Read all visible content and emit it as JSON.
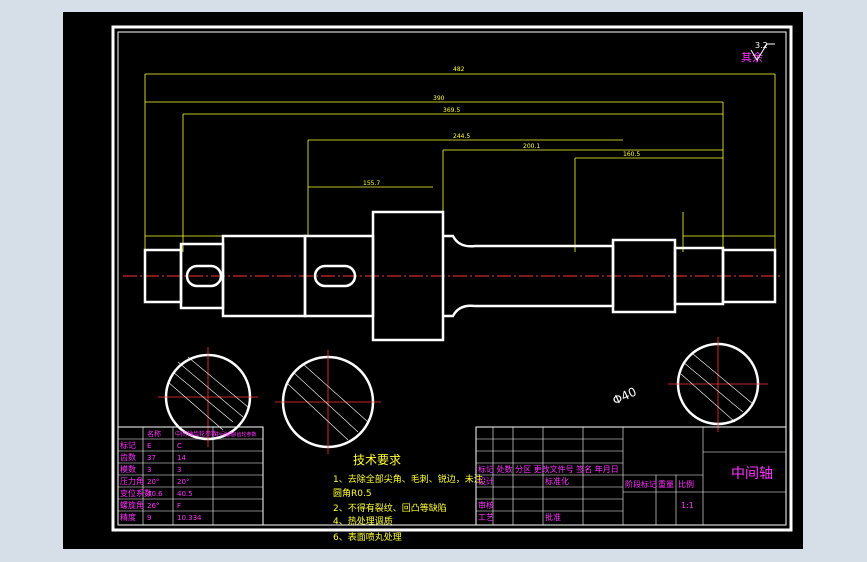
{
  "roughness_note": "其余",
  "roughness_value": "3.2",
  "dimensions": {
    "overall": "482",
    "d2": "390",
    "d3": "369.5",
    "d4": "244.5",
    "d5": "200.1",
    "d6": "160.5",
    "d7": "155.7"
  },
  "tech_req": {
    "title": "技术要求",
    "lines": [
      "1、去除全部尖角、毛刺、锐边，未注",
      "圆角R0.5",
      "2、不得有裂纹、回凸等缺陷",
      "4、热处理调质",
      "6、表面喷丸处理"
    ]
  },
  "param_table": {
    "header": [
      "名称",
      "中间轴齿轮参数",
      "中间轴轴I齿轮参数"
    ],
    "rows": [
      [
        "标记",
        "E",
        "C"
      ],
      [
        "齿数",
        "37",
        "14"
      ],
      [
        "模数",
        "3",
        "3"
      ],
      [
        "压力角",
        "20°",
        "20°"
      ],
      [
        "变位系数",
        "40.6",
        "40.5"
      ],
      [
        "螺旋角",
        "26°",
        "F"
      ],
      [
        "精度",
        "9",
        "10.334"
      ]
    ]
  },
  "title_block": {
    "name": "中间轴",
    "row_labels": "标记 处数 分区 更改文件号 签名 年月日",
    "design": "设计",
    "standard": "标准化",
    "stage": "阶段标记",
    "weight": "重量",
    "scale": "比例",
    "scale_value": "1:1",
    "review": "审核",
    "process": "工艺",
    "approve": "批准"
  },
  "diameter_label": "Φ40",
  "colors": {
    "frame": "#ffffff",
    "dim": "#ffff33",
    "text": "#ff33ff",
    "center": "#ff3333",
    "hatch": "#ffffff"
  }
}
